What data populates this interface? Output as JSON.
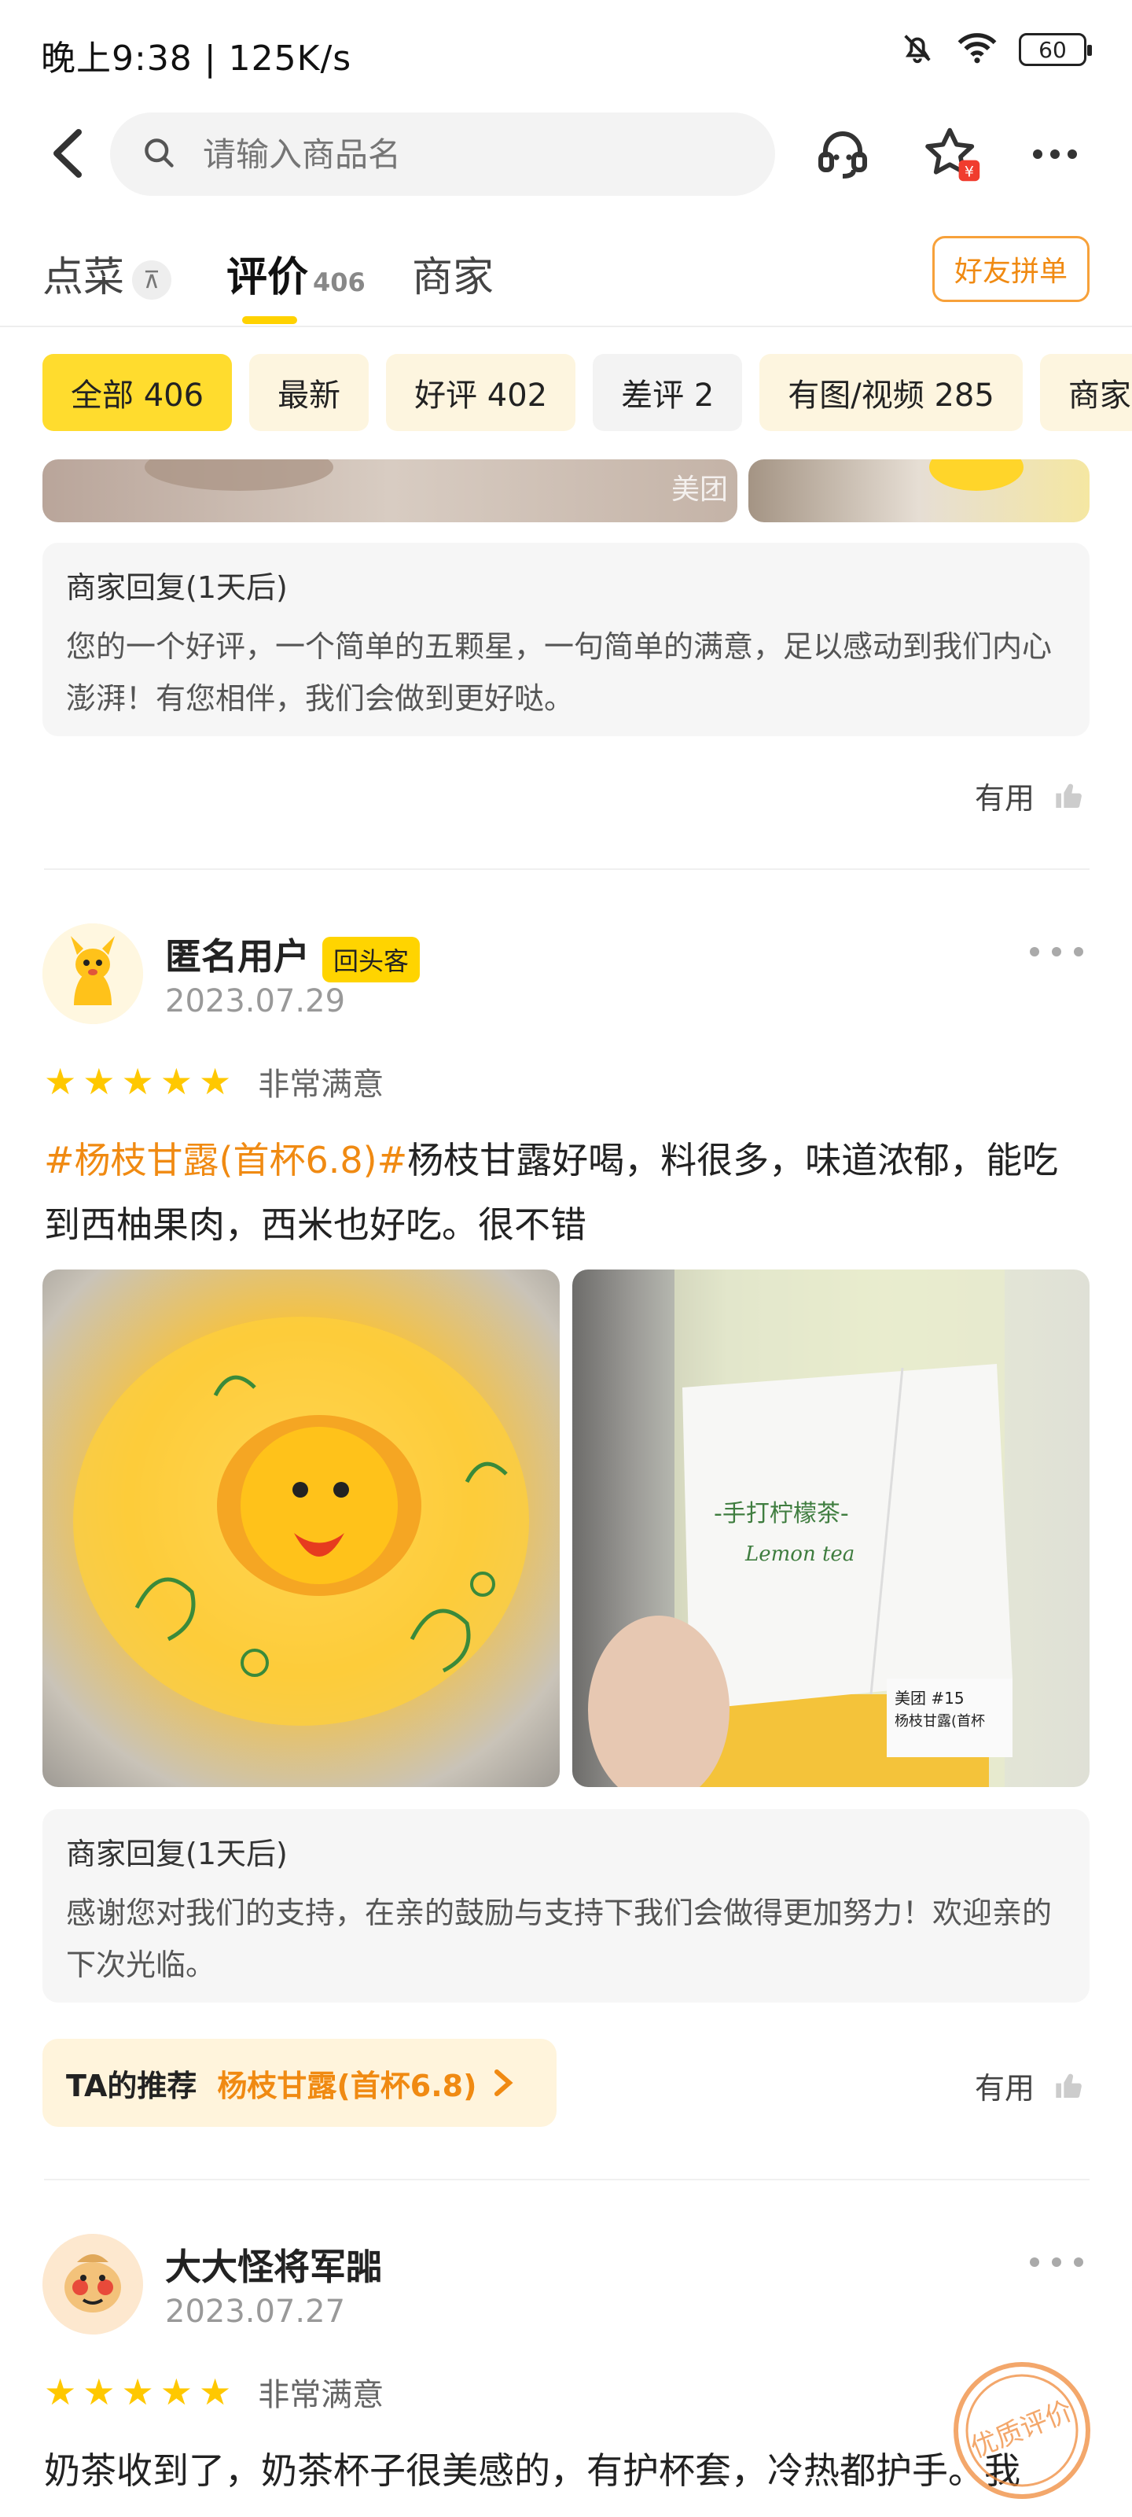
{
  "status_bar": {
    "time": "晚上9:38 | 125K/s",
    "battery": "60"
  },
  "header": {
    "search_placeholder": "请输入商品名"
  },
  "tabs": [
    {
      "label": "点菜"
    },
    {
      "label": "评价",
      "count": "406"
    },
    {
      "label": "商家"
    }
  ],
  "group_button": "好友拼单",
  "filters": [
    "全部 406",
    "最新",
    "好评 402",
    "差评 2",
    "有图/视频 285",
    "商家"
  ],
  "top_reply": {
    "title": "商家回复(1天后)",
    "text": "您的一个好评，一个简单的五颗星，一句简单的满意，足以感动到我们内心澎湃！有您相伴，我们会做到更好哒。",
    "useful": "有用"
  },
  "reviews": [
    {
      "user": "匿名用户",
      "badge": "回头客",
      "date": "2023.07.29",
      "rating_text": "非常满意",
      "stars": 5,
      "tag": "#杨枝甘露(首杯6.8)#",
      "text": "杨枝甘露好喝，料很多，味道浓郁，能吃到西柚果肉，西米也好吃。很不错",
      "reply_title": "商家回复(1天后)",
      "reply_text": "感谢您对我们的支持，在亲的鼓励与支持下我们会做得更加努力！欢迎亲的下次光临。",
      "rec_label": "TA的推荐",
      "rec_item": "杨枝甘露(首杯6.8)",
      "useful": "有用"
    },
    {
      "user": "大大怪将军嘂",
      "date": "2023.07.27",
      "rating_text": "非常满意",
      "stars": 5,
      "text": "奶茶收到了，奶茶杯子很美感的，有护杯套，冷热都护手。我"
    }
  ],
  "cup_sleeve": {
    "brand": "-手打柠檬茶-",
    "brand_en": "Lemon tea",
    "ticket_no": "美团 #15",
    "ticket_item": "杨枝甘露(首杯"
  },
  "stamp_text": "优质评价",
  "colors": {
    "accent_yellow": "#ffd200",
    "orange": "#f08a12",
    "chip_bg": "#fdf5df"
  }
}
